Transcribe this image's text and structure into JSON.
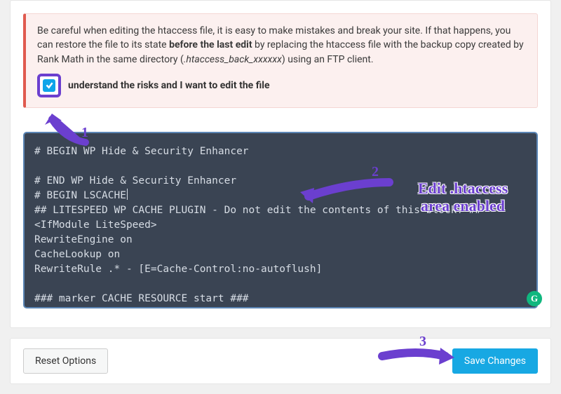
{
  "warning": {
    "text_before_bold": "Be careful when editing the htaccess file, it is easy to make mistakes and break your site. If that happens, you can restore the file to its state ",
    "bold": "before the last edit",
    "text_after_bold": " by replacing the htaccess file with the backup copy created by Rank Math in the same directory (",
    "italic": ".htaccess_back_xxxxxx",
    "text_after_italic": ") using an FTP client."
  },
  "consent": {
    "label_prefix": "",
    "label": "understand the risks and I want to edit the file",
    "checked": true
  },
  "htaccess": {
    "lines": [
      "# BEGIN WP Hide & Security Enhancer",
      "",
      "# END WP Hide & Security Enhancer",
      "# BEGIN LSCACHE",
      "## LITESPEED WP CACHE PLUGIN - Do not edit the contents of this block! ##",
      "<IfModule LiteSpeed>",
      "RewriteEngine on",
      "CacheLookup on",
      "RewriteRule .* - [E=Cache-Control:no-autoflush]",
      "",
      "### marker CACHE RESOURCE start ###"
    ],
    "cursor_line": 3
  },
  "footer": {
    "reset": "Reset Options",
    "save": "Save Changes"
  },
  "annotations": {
    "n1": "1",
    "n2": "2",
    "n3": "3",
    "caption": "Edit .htaccess\narea enabled"
  },
  "icons": {
    "grammarly": "G"
  }
}
